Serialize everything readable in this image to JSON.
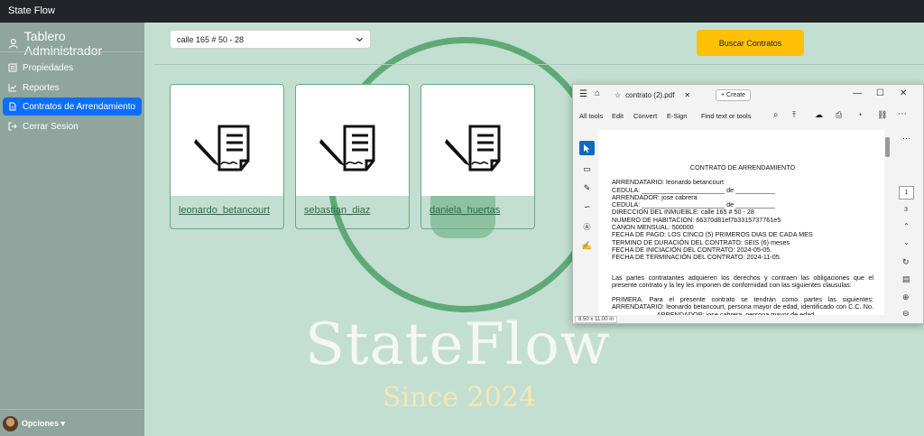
{
  "app": {
    "brand": "State Flow"
  },
  "sidebar": {
    "title": "Tablero Administrador",
    "items": [
      {
        "label": "Propiedades",
        "icon": "building-icon",
        "active": false
      },
      {
        "label": "Reportes",
        "icon": "chart-icon",
        "active": false
      },
      {
        "label": "Contratos de Arrendamiento",
        "icon": "document-icon",
        "active": true
      },
      {
        "label": "Cerrar Sesion",
        "icon": "logout-icon",
        "active": false
      }
    ],
    "options_label": "Opciones ▾"
  },
  "search": {
    "selected_address": "calle 165 # 50 - 28",
    "button_label": "Buscar Contratos"
  },
  "contracts": [
    {
      "name": "leonardo_betancourt"
    },
    {
      "name": "sebastian_diaz"
    },
    {
      "name": "daniela_huertas"
    }
  ],
  "watermark": {
    "title": "StateFlow",
    "subtitle": "Since 2024"
  },
  "pdf_viewer": {
    "tab_title": "contrato (2).pdf",
    "create_label": "Create",
    "toolbar": {
      "all_tools": "All tools",
      "edit": "Edit",
      "convert": "Convert",
      "esign": "E-Sign",
      "find": "Find text or tools"
    },
    "current_page": "1",
    "total_pages": "3",
    "page_size": "8.50 x 11.00 in",
    "document": {
      "heading": "CONTRATO DE ARRENDAMIENTO",
      "lines": [
        "ARRENDATARIO: leonardo betancourt",
        "CEDULA: _______________________ de ___________",
        "ARRENDADOR: jose cabrera",
        "CEDULA: _______________________ de ___________",
        "DIRECCION DEL INMUEBLE: calle 165 # 50 - 28",
        "NUMERO DE HABITACION: 66370d81ef7b3315737761e5",
        "CANON MENSUAL: 500000",
        "FECHA DE PAGO: LOS CINCO (5) PRIMEROS DIAS DE CADA MES",
        "TERMINO DE DURACIÓN DEL CONTRATO: SEIS (6) meses",
        "FECHA DE INICIACIÓN DEL CONTRATO: 2024-05-05.",
        "FECHA DE TERMINACIÓN DEL CONTRATO: 2024-11-05."
      ],
      "para1": "Las partes contratantes adquieren los derechos y contraen las obligaciones que el presente contrato y la ley les imponen de conformidad con las siguientes clausulas:",
      "para2": "PRIMERA. Para el presente contrato se tendrán como partes las siguientes: ARRENDATARIO: leonardo betancourt, persona mayor de edad, identificado con C.C. No. ____________ ARRENDADOR: jose cabrera, persona mayor de edad"
    }
  }
}
